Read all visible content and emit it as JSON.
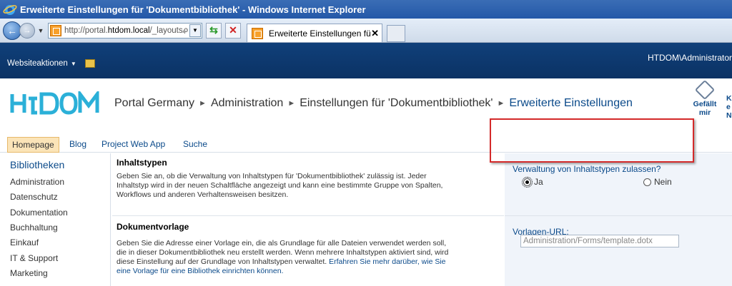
{
  "window": {
    "title": "Erweiterte Einstellungen für 'Dokumentbibliothek' - Windows Internet Explorer"
  },
  "browser": {
    "address_prefix": "http://portal.",
    "address_domain": "htdom.local",
    "address_suffix": "/_layouts/",
    "tab_title": "Erweiterte Einstellungen für '..."
  },
  "topbar": {
    "site_actions": "Websiteaktionen",
    "user": "HTDOM\\Administrator"
  },
  "header": {
    "logo": "HtDOM",
    "breadcrumb": [
      "Portal Germany",
      "Administration",
      "Einstellungen für 'Dokumentbibliothek'",
      "Erweiterte Einstellungen"
    ],
    "likeit_line1": "Gefällt",
    "likeit_line2": "mir",
    "notes_line1": "K",
    "notes_line2": "e",
    "notes_line3": "N"
  },
  "topnav": [
    "Homepage",
    "Blog",
    "Project Web App",
    "Suche"
  ],
  "leftnav": {
    "heading": "Bibliotheken",
    "items": [
      "Administration",
      "Datenschutz",
      "Dokumentation",
      "Buchhaltung",
      "Einkauf",
      "IT & Support",
      "Marketing"
    ]
  },
  "sections": {
    "content_types": {
      "title": "Inhaltstypen",
      "description": "Geben Sie an, ob die Verwaltung von Inhaltstypen für 'Dokumentbibliothek' zulässig ist. Jeder Inhaltstyp wird in der neuen Schaltfläche angezeigt und kann eine bestimmte Gruppe von Spalten, Workflows und anderen Verhaltensweisen besitzen.",
      "field_label": "Verwaltung von Inhaltstypen zulassen?",
      "option_yes": "Ja",
      "option_no": "Nein",
      "selected": "Ja"
    },
    "template": {
      "title": "Dokumentvorlage",
      "description": "Geben Sie die Adresse einer Vorlage ein, die als Grundlage für alle Dateien verwendet werden soll, die in dieser Dokumentbibliothek neu erstellt werden. Wenn mehrere Inhaltstypen aktiviert sind, wird diese Einstellung auf der Grundlage von Inhaltstypen verwaltet.",
      "link": "Erfahren Sie mehr darüber, wie Sie eine Vorlage für eine Bibliothek einrichten können.",
      "field_label": "Vorlagen-URL:",
      "url_value": "Administration/Forms/template.dotx"
    }
  },
  "colors": {
    "topbar": "#0b3264",
    "link": "#0b4a8a",
    "logo": "#2bb0d8",
    "highlight": "#d42a2a",
    "selected_tab": "#fbe4b8"
  }
}
